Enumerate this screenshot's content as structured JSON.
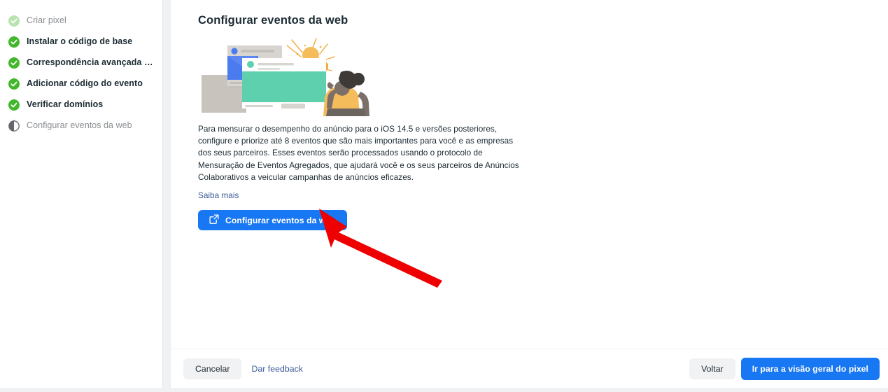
{
  "sidebar": {
    "steps": [
      {
        "label": "Criar pixel",
        "state": "complete-muted",
        "icon": "check-circle-icon"
      },
      {
        "label": "Instalar o código de base",
        "state": "complete",
        "icon": "check-circle-icon"
      },
      {
        "label": "Correspondência avançada automát…",
        "state": "complete",
        "icon": "check-circle-icon"
      },
      {
        "label": "Adicionar código do evento",
        "state": "complete",
        "icon": "check-circle-icon"
      },
      {
        "label": "Verificar domínios",
        "state": "complete",
        "icon": "check-circle-icon"
      },
      {
        "label": "Configurar eventos da web",
        "state": "in-progress",
        "icon": "half-circle-icon"
      }
    ]
  },
  "main": {
    "title": "Configurar eventos da web",
    "illustration_name": "person-viewing-web-events-illustration",
    "body_text": "Para mensurar o desempenho do anúncio para o iOS 14.5 e versões posteriores, configure e priorize até 8 eventos que são mais importantes para você e as empresas dos seus parceiros. Esses eventos serão processados usando o protocolo de Mensuração de Eventos Agregados, que ajudará você e os seus parceiros de Anúncios Colaborativos a veicular campanhas de anúncios eficazes.",
    "learn_more_label": "Saiba mais",
    "cta_label": "Configurar eventos da web",
    "cta_icon": "external-link-icon"
  },
  "footer": {
    "cancel_label": "Cancelar",
    "feedback_label": "Dar feedback",
    "back_label": "Voltar",
    "primary_label": "Ir para a visão geral do pixel"
  },
  "annotation": {
    "type": "red-arrow",
    "points_to": "configurar-eventos-da-web-button",
    "color": "#ef0000"
  },
  "colors": {
    "brand_blue": "#1877f2",
    "link_blue": "#3b5998",
    "success_green": "#42b72a",
    "text_dark": "#1c2b33",
    "text_muted": "#8a8d91",
    "annotation_red": "#ef0000"
  }
}
